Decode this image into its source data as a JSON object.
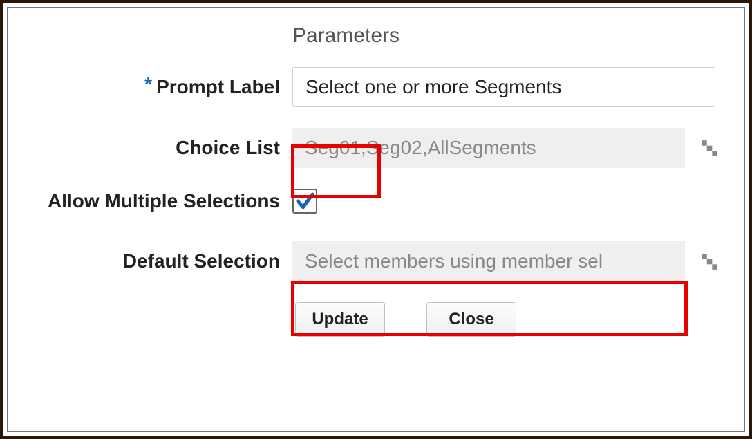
{
  "heading": "Parameters",
  "rows": {
    "prompt_label": {
      "label": "Prompt Label",
      "value": "Select one or more Segments",
      "required": "*"
    },
    "choice_list": {
      "label": "Choice List",
      "value": "Seg01,Seg02,AllSegments"
    },
    "allow_multi": {
      "label": "Allow Multiple Selections",
      "checked": true
    },
    "default_sel": {
      "label": "Default Selection",
      "placeholder": "Select members using member sel"
    }
  },
  "buttons": {
    "update": "Update",
    "close": "Close"
  },
  "icons": {
    "hierarchy": "hierarchy-icon",
    "checkmark": "checkmark-icon"
  }
}
